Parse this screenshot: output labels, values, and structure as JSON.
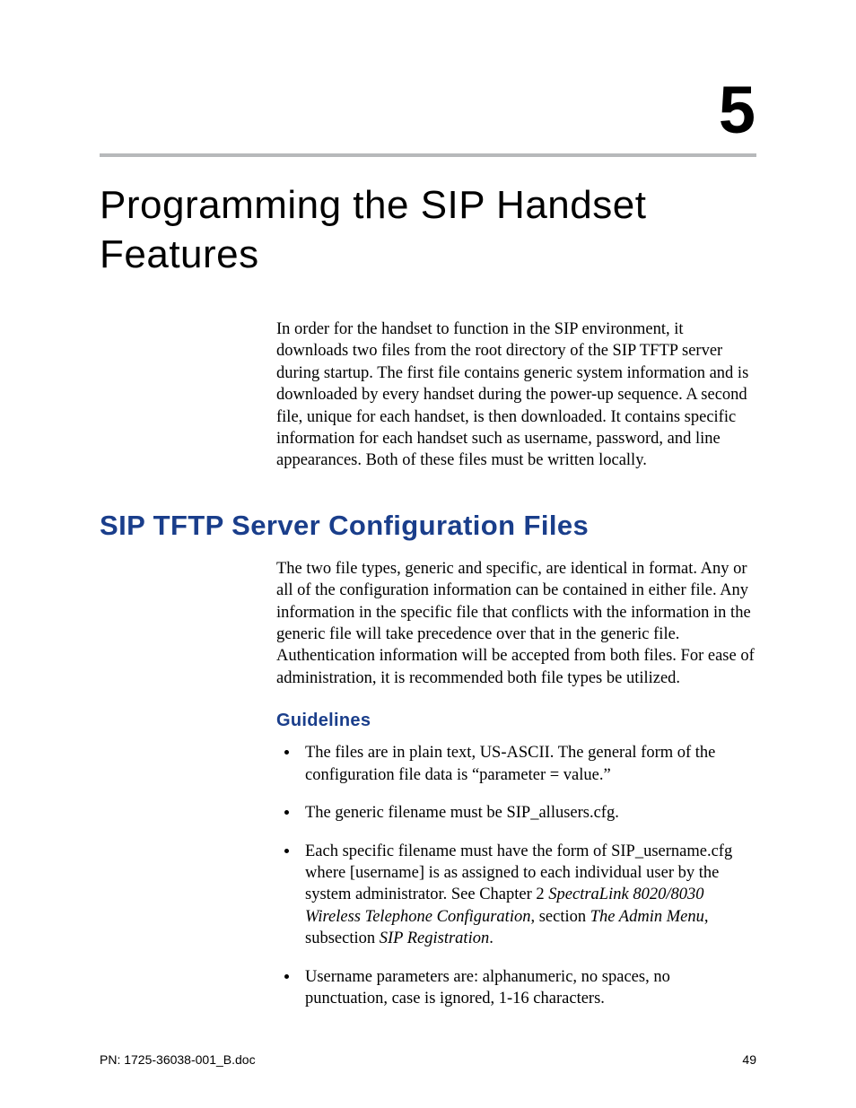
{
  "chapter": {
    "number": "5",
    "title": "Programming the SIP Handset Features"
  },
  "intro_paragraph": "In order for the handset to function in the SIP environment, it downloads two files from the root directory of the SIP TFTP server during startup. The first file contains generic system information and is downloaded by every handset during the power-up sequence. A second file, unique for each handset, is then downloaded. It contains specific information for each handset such as username, password, and line appearances. Both of these files must be written locally.",
  "section": {
    "heading": "SIP TFTP Server Configuration Files",
    "paragraph": "The two file types, generic and specific, are identical in format. Any or all of the configuration information can be contained in either file. Any information in the specific file that conflicts with the information in the generic file will take precedence over that in the generic file. Authentication information will be accepted from both files. For ease of administration, it is recommended both file types be utilized.",
    "sub_heading": "Guidelines",
    "bullets": {
      "b0": "The files are in plain text, US-ASCII. The general form of the configuration file data is “parameter = value.”",
      "b1": "The generic filename must be SIP_allusers.cfg.",
      "b2_pre": "Each specific filename must have the form of SIP_username.cfg where [username] is as assigned to each individual user by the system administrator. See Chapter 2 ",
      "b2_i1": "SpectraLink 8020/8030 Wireless Telephone Configuration",
      "b2_mid1": ", section ",
      "b2_i2": "The Admin Menu",
      "b2_mid2": ", subsection ",
      "b2_i3": "SIP Registration",
      "b2_post": ".",
      "b3": "Username parameters are: alphanumeric, no spaces, no punctuation, case is ignored, 1-16 characters."
    }
  },
  "footer": {
    "left": "PN: 1725-36038-001_B.doc",
    "right": "49"
  }
}
